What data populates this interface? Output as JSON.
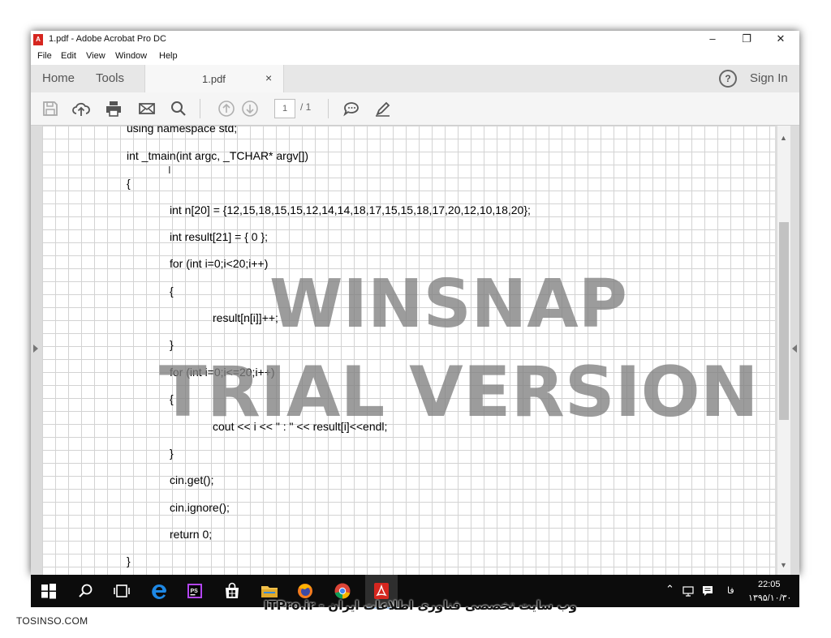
{
  "window": {
    "title": "1.pdf - Adobe Acrobat Pro DC",
    "app_icon_label": "A"
  },
  "window_controls": {
    "minimize": "–",
    "maximize": "❐",
    "close": "✕"
  },
  "menu": [
    "File",
    "Edit",
    "View",
    "Window",
    "Help"
  ],
  "tabs": {
    "home": "Home",
    "tools": "Tools",
    "document": "1.pdf",
    "close": "×",
    "help": "?",
    "sign_in": "Sign In"
  },
  "toolbar": {
    "icons": [
      "save-icon",
      "upload-icon",
      "print-icon",
      "email-icon",
      "search-icon",
      "page-up-icon",
      "page-down-icon",
      "comment-icon",
      "sign-icon"
    ],
    "current_page": "1",
    "total_pages": "/ 1"
  },
  "code_lines": [
    "using namespace std;",
    "int _tmain(int argc, _TCHAR* argv[])",
    "{",
    "int n[20] = {12,15,18,15,15,12,14,14,18,17,15,15,18,17,20,12,10,18,20};",
    "int result[21] = { 0 };",
    "for (int i=0;i<20;i++)",
    "{",
    "result[n[i]]++;",
    "}",
    "for (int i=0;i<=20;i++)",
    "{",
    "cout << i << \" : \" << result[i]<<endl;",
    "}",
    "cin.get();",
    "cin.ignore();",
    "return 0;",
    "}"
  ],
  "watermark": {
    "line1": "WINSNAP",
    "line2": "TRIAL VERSION"
  },
  "taskbar": {
    "icons": [
      "windows-start-icon",
      "search-icon",
      "task-view-icon",
      "edge-icon",
      "phpstorm-icon",
      "store-icon",
      "file-explorer-icon",
      "firefox-icon",
      "chrome-icon",
      "acrobat-icon"
    ],
    "language": "فا",
    "time": "22:05",
    "date": "۱۳۹۵/۱۰/۳۰"
  },
  "caption": "ITPro.ir - وب سایت تخصصی فناوری اطلاعات ایران",
  "site_watermark": "TOSINSO.COM",
  "colors": {
    "acrobat_red": "#d6261f",
    "taskbar": "#0c0c0c",
    "watermark_gray": "#808080"
  }
}
